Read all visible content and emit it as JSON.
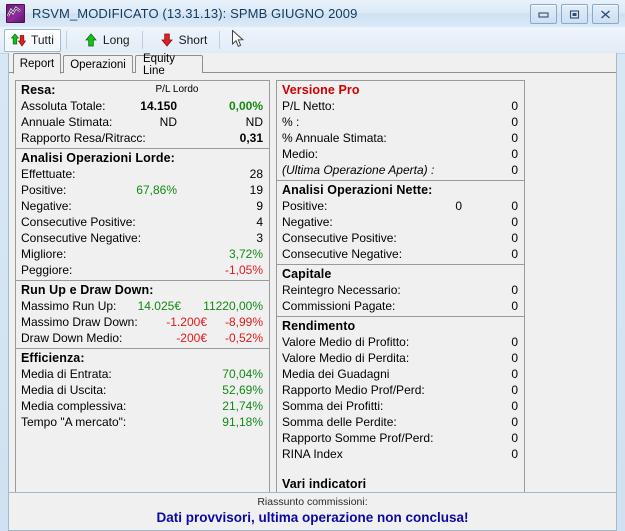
{
  "window": {
    "title": "RSVM_MODIFICATO (13.31.13): SPMB GIUGNO 2009",
    "icon": "chart-line-icon",
    "buttons": {
      "minimize": "minimize-icon",
      "maximize": "maximize-icon",
      "close": "close-icon"
    }
  },
  "toolbar": {
    "buttons": [
      {
        "label": "Tutti",
        "icon": "up-down-arrow-icon",
        "active": true
      },
      {
        "label": "Long",
        "icon": "up-arrow-icon",
        "active": false
      },
      {
        "label": "Short",
        "icon": "down-arrow-icon",
        "active": false
      }
    ]
  },
  "tabs": [
    {
      "label": "Report",
      "selected": true
    },
    {
      "label": "Operazioni",
      "selected": false
    },
    {
      "label": "Equity Line",
      "selected": false
    }
  ],
  "left_panel": {
    "resa": {
      "head": "Resa:",
      "col_note": "P/L Lordo",
      "rows": [
        {
          "label": "Assoluta Totale:",
          "mid": "14.150",
          "mid_bold": true,
          "value": "0,00%",
          "value_color": "green",
          "value_bold": true
        },
        {
          "label": "Annuale Stimata:",
          "mid": "ND",
          "value": "ND"
        },
        {
          "label": "Rapporto Resa/Ritracc:",
          "mid": "",
          "value": "0,31",
          "value_bold": true
        }
      ]
    },
    "analisi_lorde": {
      "head": "Analisi Operazioni Lorde:",
      "rows": [
        {
          "label": "Effettuate:",
          "mid": "",
          "value": "28"
        },
        {
          "label": "Positive:",
          "mid": "67,86%",
          "mid_color": "green",
          "value": "19"
        },
        {
          "label": "Negative:",
          "mid": "",
          "value": "9"
        },
        {
          "label": "Consecutive Positive:",
          "mid": "",
          "value": "4"
        },
        {
          "label": "Consecutive Negative:",
          "mid": "",
          "value": "3"
        },
        {
          "label": "Migliore:",
          "mid": "",
          "value": "3,72%",
          "value_color": "green"
        },
        {
          "label": "Peggiore:",
          "mid": "",
          "value": "-1,05%",
          "value_color": "red"
        }
      ]
    },
    "run_up_draw_down": {
      "head": "Run Up e Draw Down:",
      "rows": [
        {
          "label": "Massimo Run Up:",
          "mid": "14.025€",
          "mid_color": "green",
          "value": "11220,00%",
          "value_color": "green"
        },
        {
          "label": "Massimo Draw Down:",
          "mid": "-1.200€",
          "mid_color": "red",
          "value": "-8,99%",
          "value_color": "red"
        },
        {
          "label": "Draw Down Medio:",
          "mid": "-200€",
          "mid_color": "red",
          "value": "-0,52%",
          "value_color": "red"
        }
      ]
    },
    "efficienza": {
      "head": "Efficienza:",
      "rows": [
        {
          "label": "Media di Entrata:",
          "mid": "",
          "value": "70,04%",
          "value_color": "green"
        },
        {
          "label": "Media di Uscita:",
          "mid": "",
          "value": "52,69%",
          "value_color": "green"
        },
        {
          "label": "Media complessiva:",
          "mid": "",
          "value": "21,74%",
          "value_color": "green"
        },
        {
          "label": "Tempo \"A mercato\":",
          "mid": "",
          "value": "91,18%",
          "value_color": "green"
        }
      ]
    }
  },
  "right_panel": {
    "versione_pro": {
      "head": "Versione Pro",
      "rows": [
        {
          "label": "P/L Netto:",
          "mid": "",
          "value": "0"
        },
        {
          "label": "% :",
          "mid": "",
          "value": "0"
        },
        {
          "label": "% Annuale Stimata:",
          "mid": "",
          "value": "0"
        },
        {
          "label": "Medio:",
          "mid": "",
          "value": "0"
        },
        {
          "label": "(Ultima Operazione Aperta) :",
          "mid": "",
          "value": "0",
          "italic": true
        }
      ]
    },
    "analisi_nette": {
      "head": "Analisi Operazioni Nette:",
      "rows": [
        {
          "label": "Positive:",
          "mid": "0",
          "value": "0"
        },
        {
          "label": "Negative:",
          "mid": "",
          "value": "0"
        },
        {
          "label": "Consecutive Positive:",
          "mid": "",
          "value": "0"
        },
        {
          "label": "Consecutive Negative:",
          "mid": "",
          "value": "0"
        }
      ]
    },
    "capitale": {
      "head": "Capitale",
      "rows": [
        {
          "label": "Reintegro Necessario:",
          "mid": "",
          "value": "0"
        },
        {
          "label": "Commissioni Pagate:",
          "mid": "",
          "value": "0"
        }
      ]
    },
    "rendimento": {
      "head": "Rendimento",
      "rows": [
        {
          "label": "Valore Medio di Profitto:",
          "mid": "",
          "value": "0"
        },
        {
          "label": "Valore Medio di Perdita:",
          "mid": "",
          "value": "0"
        },
        {
          "label": "Media dei Guadagni",
          "mid": "",
          "value": "0"
        },
        {
          "label": "Rapporto Medio Prof/Perd:",
          "mid": "",
          "value": "0"
        },
        {
          "label": "Somma dei Profitti:",
          "mid": "",
          "value": "0"
        },
        {
          "label": "Somma delle Perdite:",
          "mid": "",
          "value": "0"
        },
        {
          "label": "Rapporto Somme Prof/Perd:",
          "mid": "",
          "value": "0"
        },
        {
          "label": "RINA Index",
          "mid": "",
          "value": "0"
        }
      ]
    },
    "vari_indicatori": {
      "head": "Vari indicatori",
      "rows": []
    }
  },
  "footer": {
    "note": "Riassunto commissioni:",
    "warning": "Dati provvisori, ultima operazione non conclusa!"
  },
  "colors": {
    "positive": "#138a13",
    "negative": "#e01b1b",
    "pro_header": "#d00000",
    "warning": "#0a0aa0"
  }
}
